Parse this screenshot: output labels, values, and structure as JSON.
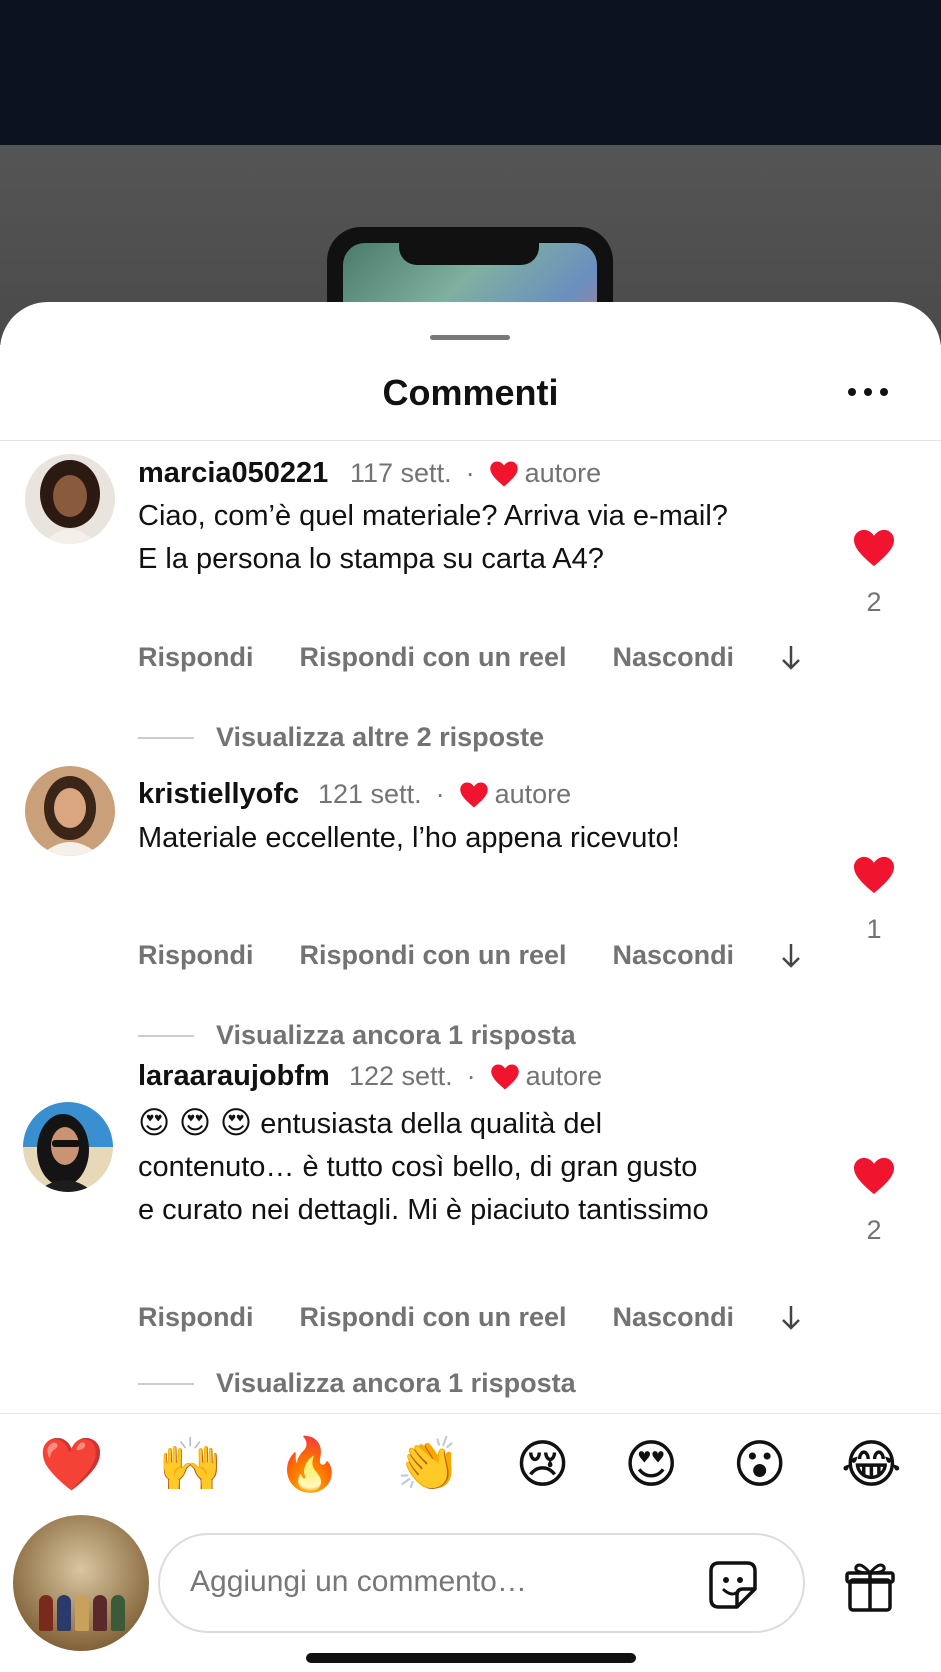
{
  "sheet": {
    "title": "Commenti"
  },
  "comments": [
    {
      "username": "marcia050221",
      "time": "117 sett.",
      "author_label": "autore",
      "text_lines": [
        "Ciao, com’è quel materiale? Arriva via e-mail?",
        "E la persona lo stampa su carta A4?"
      ],
      "like_count": "2",
      "actions": {
        "reply": "Rispondi",
        "reel": "Rispondi con un reel",
        "hide": "Nascondi"
      },
      "replies_label": "Visualizza altre 2 risposte"
    },
    {
      "username": "kristiellyofc",
      "time": "121 sett.",
      "author_label": "autore",
      "text_lines": [
        "Materiale eccellente, l’ho appena ricevuto!"
      ],
      "like_count": "1",
      "actions": {
        "reply": "Rispondi",
        "reel": "Rispondi con un reel",
        "hide": "Nascondi"
      },
      "replies_label": "Visualizza ancora 1 risposta"
    },
    {
      "username": "laraaraujobfm",
      "time": "122 sett.",
      "author_label": "autore",
      "emoji_prefix": "😍 😍 😍",
      "text_lines": [
        " entusiasta della qualità del",
        "contenuto… è tutto così bello, di gran gusto",
        "e curato nei dettagli. Mi è piaciuto tantissimo"
      ],
      "like_count": "2",
      "actions": {
        "reply": "Rispondi",
        "reel": "Rispondi con un reel",
        "hide": "Nascondi"
      },
      "replies_label": "Visualizza ancora 1 risposta"
    }
  ],
  "reactions": [
    "❤️",
    "🙌",
    "🔥",
    "👏",
    "😢",
    "😍",
    "😮",
    "😂"
  ],
  "composer": {
    "placeholder": "Aggiungi un commento…"
  },
  "colors": {
    "like_red": "#f0142f",
    "secondary_text": "#737373",
    "top_bar": "#0d1220"
  },
  "icons": [
    "more-icon",
    "heart-icon",
    "arrow-down-icon",
    "sticker-icon",
    "gift-icon"
  ]
}
